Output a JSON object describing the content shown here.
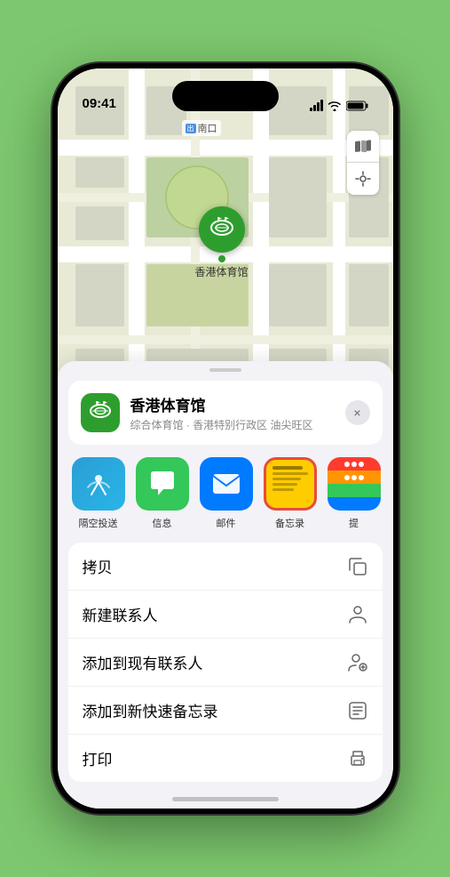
{
  "statusBar": {
    "time": "09:41",
    "locationIcon": "▶"
  },
  "mapControls": {
    "mapIcon": "🗺",
    "locationIcon": "⌖"
  },
  "venuePinLabel": "香港体育馆",
  "mapLabel": {
    "prefix": "南口",
    "iconText": "出"
  },
  "venueHeader": {
    "name": "香港体育馆",
    "subtitle": "综合体育馆 · 香港特别行政区 油尖旺区",
    "closeLabel": "×"
  },
  "shareItems": [
    {
      "label": "隔空投送",
      "type": "airdrop"
    },
    {
      "label": "信息",
      "type": "message"
    },
    {
      "label": "邮件",
      "type": "mail"
    },
    {
      "label": "备忘录",
      "type": "notes"
    },
    {
      "label": "提",
      "type": "more"
    }
  ],
  "actionItems": [
    {
      "label": "拷贝",
      "iconType": "copy"
    },
    {
      "label": "新建联系人",
      "iconType": "person"
    },
    {
      "label": "添加到现有联系人",
      "iconType": "person-add"
    },
    {
      "label": "添加到新快速备忘录",
      "iconType": "memo"
    },
    {
      "label": "打印",
      "iconType": "printer"
    }
  ]
}
